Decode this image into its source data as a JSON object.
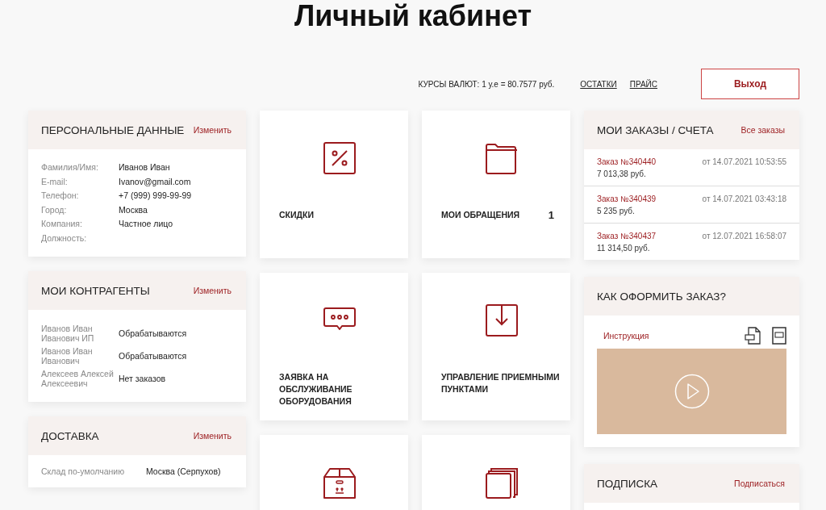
{
  "title": "Личный кабинет",
  "top_bar": {
    "rates": "КУРСЫ ВАЛЮТ: 1 у.е = 80.7577 руб.",
    "links": [
      "ОСТАТКИ",
      "ПРАЙС"
    ],
    "logout": "Выход"
  },
  "personal": {
    "title": "ПЕРСОНАЛЬНЫЕ ДАННЫЕ",
    "action": "Изменить",
    "fields": [
      {
        "label": "Фамилия/Имя:",
        "value": "Иванов Иван"
      },
      {
        "label": "E-mail:",
        "value": "Ivanov@gmail.com"
      },
      {
        "label": "Телефон:",
        "value": "+7 (999) 999-99-99"
      },
      {
        "label": "Город:",
        "value": "Москва"
      },
      {
        "label": "Компания:",
        "value": "Частное лицо"
      },
      {
        "label": "Должность:"
      }
    ]
  },
  "counterparties": {
    "title": "МОИ КОНТРАГЕНТЫ",
    "action": "Изменить",
    "rows": [
      {
        "name": "Иванов Иван Иванович ИП",
        "status": "Обрабатываются"
      },
      {
        "name": "Иванов Иван Иванович",
        "status": "Обрабатываются"
      },
      {
        "name": "Алексеев Алексей Алексеевич",
        "status": "Нет заказов"
      }
    ]
  },
  "delivery": {
    "title": "ДОСТАВКА",
    "action": "Изменить",
    "fields": [
      {
        "label": "Склад по-умолчанию",
        "value": "Москва (Серпухов)"
      }
    ]
  },
  "tiles": [
    {
      "kind": "percent",
      "label": "СКИДКИ"
    },
    {
      "kind": "folder",
      "label": "МОИ ОБРАЩЕНИЯ",
      "count": "1"
    },
    {
      "kind": "chat",
      "label": "ЗАЯВКА НА ОБСЛУЖИВАНИЕ ОБОРУДОВАНИЯ"
    },
    {
      "kind": "download",
      "label": "УПРАВЛЕНИЕ ПРИЕМНЫМИ ПУНКТАМИ"
    },
    {
      "kind": "box"
    },
    {
      "kind": "stack"
    }
  ],
  "orders": {
    "title": "МОИ ЗАКАЗЫ / СЧЕТА",
    "action": "Все заказы",
    "rows": [
      {
        "number": "Заказ №340440",
        "date": "от 14.07.2021 10:53:55",
        "sum": "7 013,38 руб."
      },
      {
        "number": "Заказ №340439",
        "date": "от 14.07.2021 03:43:18",
        "sum": "5 235 руб."
      },
      {
        "number": "Заказ №340437",
        "date": "от 12.07.2021 16:58:07",
        "sum": "11 314,50 руб."
      }
    ]
  },
  "howto": {
    "title": "КАК ОФОРМИТЬ ЗАКАЗ?",
    "link": "Инструкция",
    "files": [
      {
        "kind": "pdf"
      },
      {
        "kind": "doc"
      }
    ]
  },
  "subscription": {
    "title": "ПОДПИСКА",
    "action": "Подписаться"
  }
}
